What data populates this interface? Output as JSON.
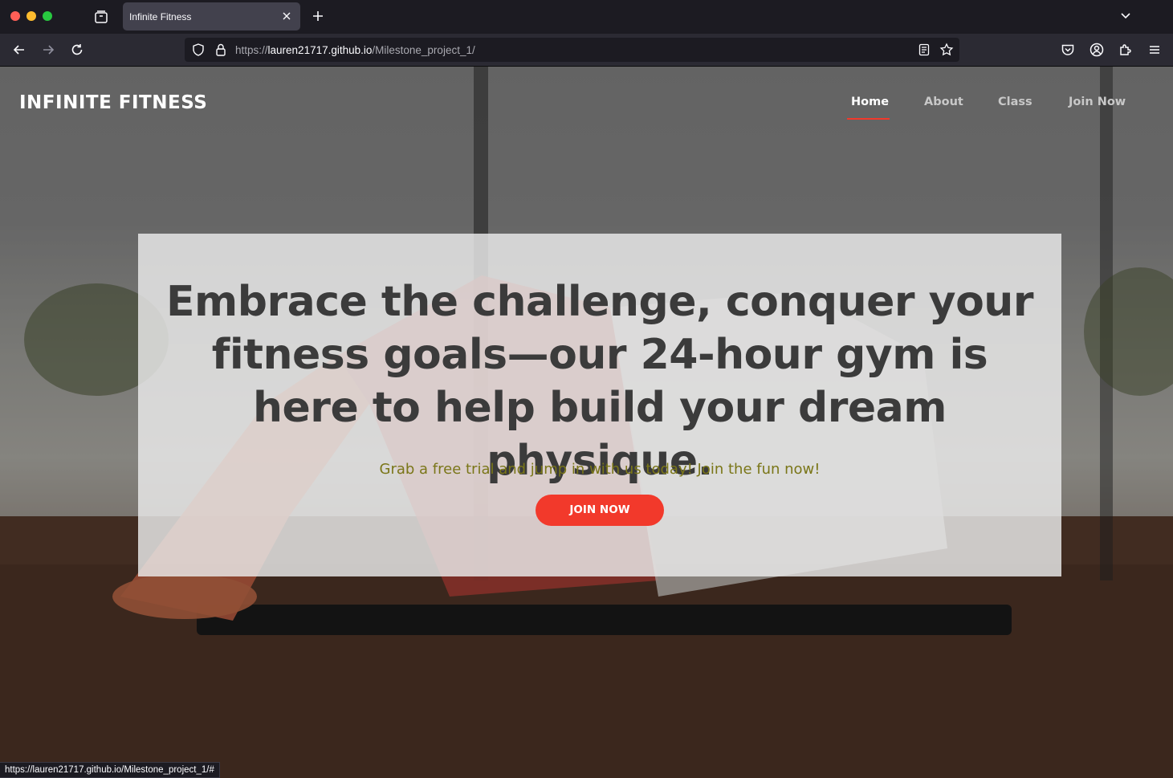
{
  "browser": {
    "tab_title": "Infinite Fitness",
    "url_prefix": "https://",
    "url_host": "lauren21717.github.io",
    "url_path": "/Milestone_project_1/",
    "status_url": "https://lauren21717.github.io/Milestone_project_1/#"
  },
  "site": {
    "brand": "INFINITE FITNESS",
    "nav": [
      {
        "label": "Home",
        "active": true
      },
      {
        "label": "About",
        "active": false
      },
      {
        "label": "Class",
        "active": false
      },
      {
        "label": "Join Now",
        "active": false
      }
    ],
    "hero": {
      "headline": "Embrace the challenge, conquer your fitness goals—our 24-hour gym is here to help build your dream physique.",
      "subtext": "Grab a free trial and jump in with us today! Join the fun now!",
      "cta_label": "JOIN NOW"
    }
  },
  "colors": {
    "accent": "#f2392b",
    "subtext": "#7a7618",
    "headline": "#3b3b3b"
  }
}
